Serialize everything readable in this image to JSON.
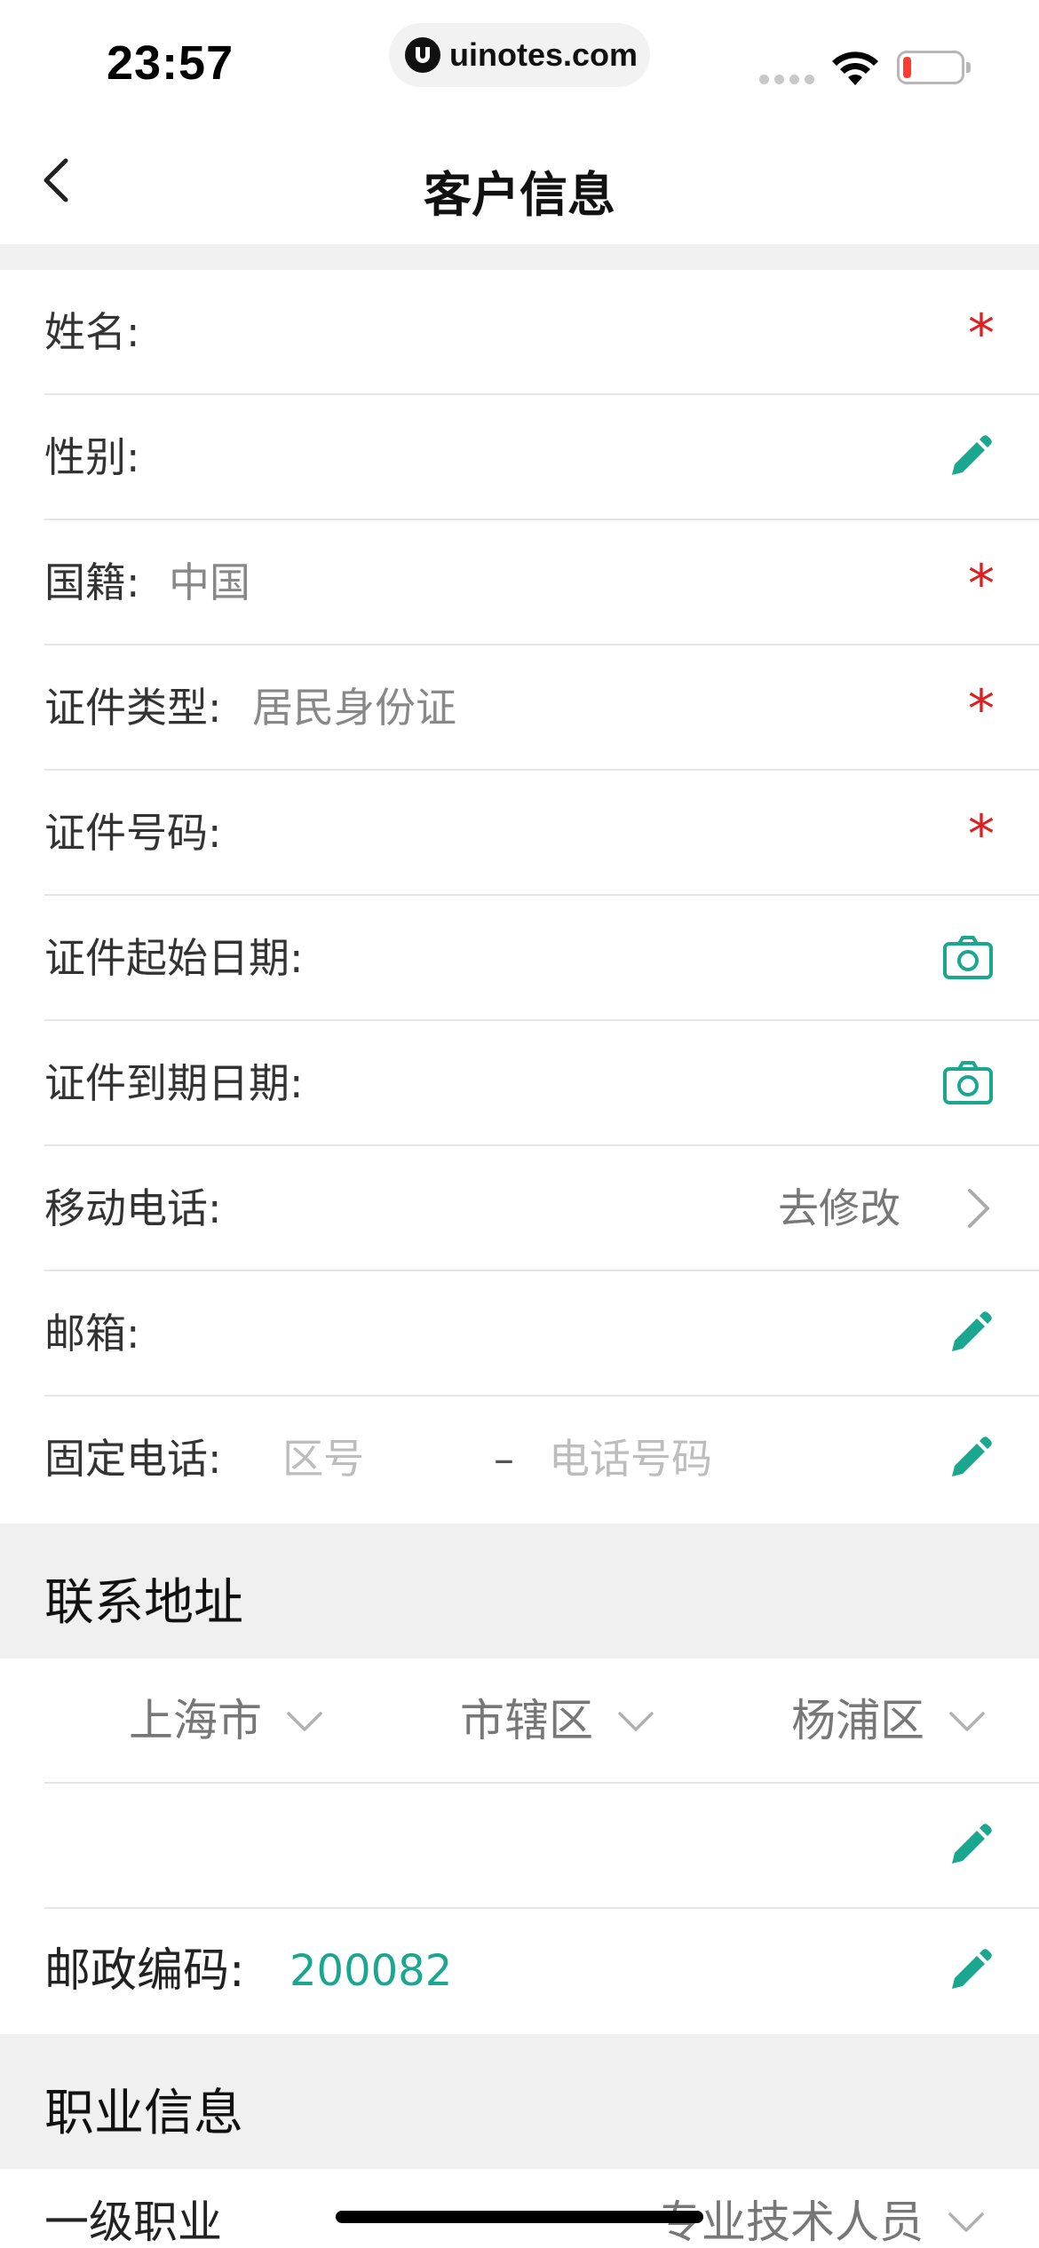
{
  "status_bar": {
    "time": "23:57",
    "url": "uinotes.com"
  },
  "nav": {
    "title": "客户信息",
    "back_icon": "chevron-left-icon"
  },
  "fields": [
    {
      "label": "姓名:",
      "value": "",
      "indicator": "required-asterisk"
    },
    {
      "label": "性别:",
      "value": "",
      "indicator": "pencil-icon"
    },
    {
      "label": "国籍:",
      "value": "中国",
      "indicator": "required-asterisk"
    },
    {
      "label": "证件类型:",
      "value": "居民身份证",
      "indicator": "required-asterisk"
    },
    {
      "label": "证件号码:",
      "value": "",
      "indicator": "required-asterisk"
    },
    {
      "label": "证件起始日期:",
      "value": "",
      "indicator": "camera-icon"
    },
    {
      "label": "证件到期日期:",
      "value": "",
      "indicator": "camera-icon"
    },
    {
      "label": "移动电话:",
      "action": "去修改",
      "indicator": "chevron-right-icon"
    },
    {
      "label": "邮箱:",
      "value": "",
      "indicator": "pencil-icon"
    },
    {
      "label": "固定电话:",
      "area_placeholder": "区号",
      "separator": "–",
      "number_placeholder": "电话号码",
      "indicator": "pencil-icon"
    }
  ],
  "required_mark": "*",
  "address": {
    "section_title": "联系地址",
    "province": "上海市",
    "city": "市辖区",
    "district": "杨浦区",
    "detail": "",
    "postal_label": "邮政编码:",
    "postal_code": "200082"
  },
  "occupation": {
    "section_title": "职业信息",
    "level1_label": "一级职业",
    "level1_value": "专业技术人员"
  },
  "colors": {
    "accent": "#1aa68f",
    "required": "#e02020",
    "section_bg": "#f0f0f0"
  }
}
